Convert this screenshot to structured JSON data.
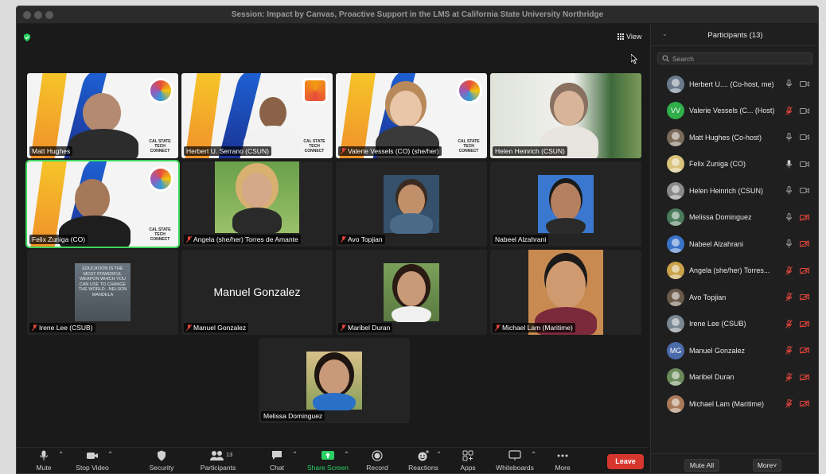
{
  "window": {
    "title": "Session: Impact by Canvas, Proactive Support in the LMS at California State University Northridge"
  },
  "view_button": {
    "label": "View"
  },
  "tiles": [
    {
      "name": "Matt Hughes",
      "muted": false
    },
    {
      "name": "Herbert U. Serrano (CSUN)",
      "muted": false
    },
    {
      "name": "Valerie Vessels (CO) (she/her)",
      "muted": true
    },
    {
      "name": "Helen Heinrich (CSUN)",
      "muted": false
    },
    {
      "name": "Felix Zuniga (CO)",
      "muted": false,
      "active": true
    },
    {
      "name": "Angela (she/her) Torres de Amante",
      "muted": true
    },
    {
      "name": "Avo Topjian",
      "muted": true
    },
    {
      "name": "Nabeel Alzahrani",
      "muted": false
    },
    {
      "name": "Irene Lee (CSUB)",
      "muted": true
    },
    {
      "name": "Manuel Gonzalez",
      "muted": true,
      "display_name": "Manuel Gonzalez"
    },
    {
      "name": "Maribel Duran",
      "muted": true
    },
    {
      "name": "Michael Lam (Maritime)",
      "muted": true
    },
    {
      "name": "Melissa Dominguez",
      "muted": false
    }
  ],
  "banner": {
    "line1": "CAL STATE TECH",
    "line2": "CONNECT"
  },
  "irene_quote": "EDUCATION IS THE MOST POWERFUL WEAPON WHICH YOU CAN USE TO CHANGE THE WORLD. -NELSON MANDELA",
  "toolbar": {
    "mute": "Mute",
    "stop_video": "Stop Video",
    "security": "Security",
    "participants": "Participants",
    "participants_count": "13",
    "chat": "Chat",
    "share_screen": "Share Screen",
    "record": "Record",
    "reactions": "Reactions",
    "apps": "Apps",
    "whiteboards": "Whiteboards",
    "more": "More",
    "leave": "Leave"
  },
  "panel": {
    "title": "Participants (13)",
    "search_placeholder": "Search",
    "mute_all": "Mute All",
    "more": "More"
  },
  "participants": [
    {
      "name": "Herbert U....  (Co-host, me)",
      "initials": "",
      "avatar_color": "#6b7a8c",
      "mic": "on",
      "cam": "on"
    },
    {
      "name": "Valerie Vessels (C...  (Host)",
      "initials": "VV",
      "avatar_color": "#2fae4a",
      "mic": "off",
      "cam": "on"
    },
    {
      "name": "Matt Hughes (Co-host)",
      "initials": "",
      "avatar_color": "#7a6a5a",
      "mic": "on",
      "cam": "on"
    },
    {
      "name": "Felix Zuniga (CO)",
      "initials": "",
      "avatar_color": "#d9c27a",
      "mic": "speaking",
      "cam": "on"
    },
    {
      "name": "Helen Heinrich (CSUN)",
      "initials": "",
      "avatar_color": "#8a8a8a",
      "mic": "on",
      "cam": "on"
    },
    {
      "name": "Melissa Dominguez",
      "initials": "",
      "avatar_color": "#4a7a5a",
      "mic": "on",
      "cam": "off"
    },
    {
      "name": "Nabeel Alzahrani",
      "initials": "",
      "avatar_color": "#3a72c8",
      "mic": "on",
      "cam": "off"
    },
    {
      "name": "Angela (she/her) Torres...",
      "initials": "",
      "avatar_color": "#c9a24a",
      "mic": "off",
      "cam": "off"
    },
    {
      "name": "Avo Topjian",
      "initials": "",
      "avatar_color": "#6a5a4a",
      "mic": "off",
      "cam": "off"
    },
    {
      "name": "Irene Lee (CSUB)",
      "initials": "",
      "avatar_color": "#7a8690",
      "mic": "off",
      "cam": "off"
    },
    {
      "name": "Manuel Gonzalez",
      "initials": "MG",
      "avatar_color": "#4a6aa8",
      "mic": "off",
      "cam": "off"
    },
    {
      "name": "Maribel Duran",
      "initials": "",
      "avatar_color": "#6a8a5a",
      "mic": "off",
      "cam": "off"
    },
    {
      "name": "Michael Lam (Maritime)",
      "initials": "",
      "avatar_color": "#a87a5a",
      "mic": "off",
      "cam": "off"
    }
  ],
  "colors": {
    "muted_red": "#e0453a",
    "active_green": "#3bd55a",
    "share_green": "#2bd063",
    "leave_red": "#d7362e"
  }
}
